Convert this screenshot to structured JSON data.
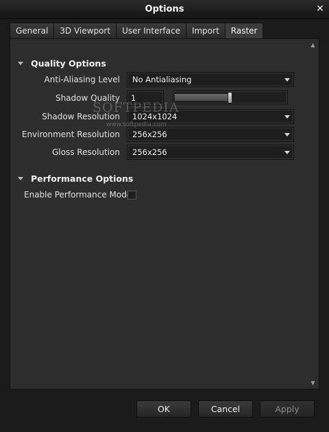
{
  "window": {
    "title": "Options",
    "close_glyph": "✕"
  },
  "tabs": [
    {
      "label": "General",
      "active": false
    },
    {
      "label": "3D Viewport",
      "active": false
    },
    {
      "label": "User Interface",
      "active": false
    },
    {
      "label": "Import",
      "active": false
    },
    {
      "label": "Raster",
      "active": true
    }
  ],
  "quality": {
    "header": "Quality Options",
    "anti_aliasing": {
      "label": "Anti-Aliasing Level",
      "value": "No Antialiasing"
    },
    "shadow_quality": {
      "label": "Shadow Quality",
      "value": "1",
      "slider_fraction": 0.5
    },
    "shadow_resolution": {
      "label": "Shadow Resolution",
      "value": "1024x1024"
    },
    "environment_resolution": {
      "label": "Environment Resolution",
      "value": "256x256"
    },
    "gloss_resolution": {
      "label": "Gloss Resolution",
      "value": "256x256"
    }
  },
  "performance": {
    "header": "Performance Options",
    "enable_mode": {
      "label": "Enable Performance Mode",
      "checked": false
    }
  },
  "watermark": {
    "text": "SOFTPEDIA",
    "url": "www.softpedia.com"
  },
  "buttons": {
    "ok": "OK",
    "cancel": "Cancel",
    "apply": "Apply"
  },
  "colors": {
    "background": "#1b1b1b",
    "panel": "#2d2d2d",
    "text": "#e6e6e6"
  }
}
